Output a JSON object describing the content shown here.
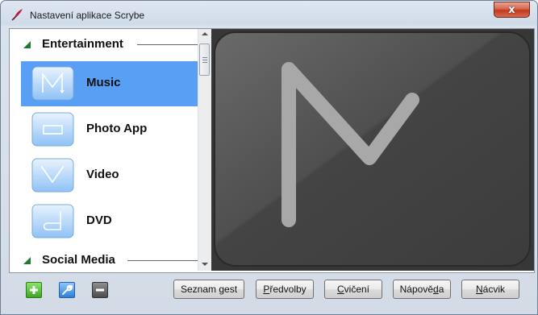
{
  "window": {
    "title": "Nastavení aplikace Scrybe",
    "close_label": "x"
  },
  "sidebar": {
    "groups": [
      {
        "label": "Entertainment"
      },
      {
        "label": "Social Media"
      }
    ],
    "items": [
      {
        "label": "Music",
        "icon": "music-gesture-icon",
        "selected": true
      },
      {
        "label": "Photo App",
        "icon": "photo-gesture-icon",
        "selected": false
      },
      {
        "label": "Video",
        "icon": "video-gesture-icon",
        "selected": false
      },
      {
        "label": "DVD",
        "icon": "dvd-gesture-icon",
        "selected": false
      }
    ]
  },
  "preview": {
    "gesture": "M-shape gesture"
  },
  "toolbar": {
    "add_icon": "plus-icon",
    "edit_icon": "wrench-icon",
    "remove_icon": "minus-icon",
    "buttons": [
      {
        "pre": "Seznam ",
        "key": "g",
        "post": "est"
      },
      {
        "pre": "",
        "key": "P",
        "post": "ředvolby"
      },
      {
        "pre": "",
        "key": "C",
        "post": "vičení"
      },
      {
        "pre": "Nápově",
        "key": "d",
        "post": "a"
      },
      {
        "pre": "",
        "key": "N",
        "post": "ácvik"
      }
    ]
  },
  "colors": {
    "selection": "#59a0f5",
    "group_arrow": "#1f7a2f",
    "preview_bg": "#373737"
  }
}
